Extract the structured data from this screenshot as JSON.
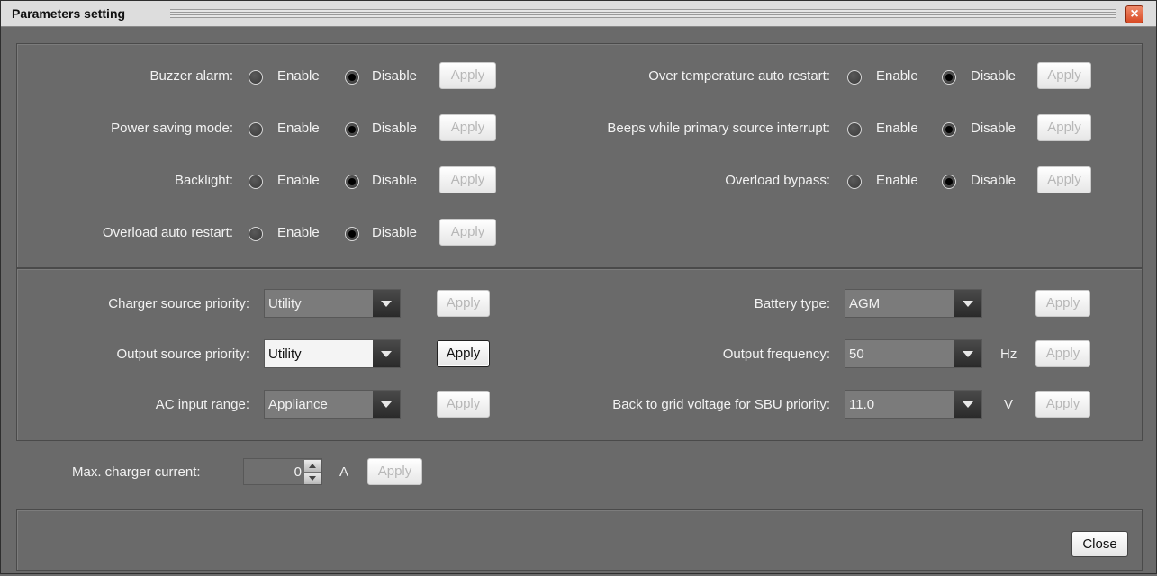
{
  "window": {
    "title": "Parameters setting"
  },
  "options": {
    "enable_label": "Enable",
    "disable_label": "Disable",
    "apply_label": "Apply"
  },
  "toggles_left": [
    {
      "label": "Buzzer alarm:",
      "selected": "Disable"
    },
    {
      "label": "Power saving mode:",
      "selected": "Disable"
    },
    {
      "label": "Backlight:",
      "selected": "Disable"
    },
    {
      "label": "Overload auto restart:",
      "selected": "Disable"
    }
  ],
  "toggles_right": [
    {
      "label": "Over temperature auto restart:",
      "selected": "Disable"
    },
    {
      "label": "Beeps while primary source interrupt:",
      "selected": "Disable"
    },
    {
      "label": "Overload bypass:",
      "selected": "Disable"
    }
  ],
  "selects_left": [
    {
      "label": "Charger source priority:",
      "value": "Utility"
    },
    {
      "label": "Output source priority:",
      "value": "Utility"
    },
    {
      "label": "AC input range:",
      "value": "Appliance"
    }
  ],
  "selects_right": [
    {
      "label": "Battery type:",
      "value": "AGM",
      "unit": ""
    },
    {
      "label": "Output frequency:",
      "value": "50",
      "unit": "Hz"
    },
    {
      "label": "Back to grid voltage for SBU priority:",
      "value": "11.0",
      "unit": "V"
    }
  ],
  "charger": {
    "label": "Max. charger current:",
    "value": "0",
    "unit": "A"
  },
  "footer": {
    "close_label": "Close"
  }
}
